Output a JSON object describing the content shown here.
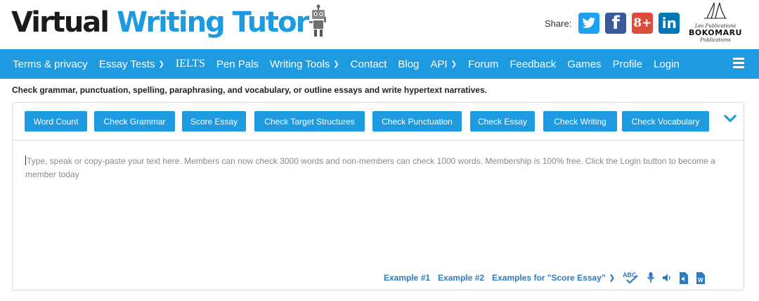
{
  "header": {
    "logo": {
      "part1": "Virtual",
      "part2": "Writing",
      "part3": "Tutor"
    },
    "share_label": "Share:",
    "social": {
      "gplus_label": "8+",
      "linkedin_label": "in"
    },
    "publisher": {
      "line1": "Les Publications",
      "line2": "BOKOMARU",
      "line3": "Publications"
    }
  },
  "nav": {
    "items": [
      {
        "label": "Terms & privacy"
      },
      {
        "label": "Essay Tests"
      },
      {
        "label": "IELTS"
      },
      {
        "label": "Pen Pals"
      },
      {
        "label": "Writing Tools"
      },
      {
        "label": "Contact"
      },
      {
        "label": "Blog"
      },
      {
        "label": "API"
      },
      {
        "label": "Forum"
      },
      {
        "label": "Feedback"
      },
      {
        "label": "Games"
      },
      {
        "label": "Profile"
      },
      {
        "label": "Login"
      }
    ]
  },
  "tagline": "Check grammar, punctuation, spelling, paraphrasing, and vocabulary, or outline essays and write hypertext narratives.",
  "toolbar": {
    "buttons": [
      {
        "label": "Word Count"
      },
      {
        "label": "Check Grammar"
      },
      {
        "label": "Score Essay"
      },
      {
        "label": "Check Target Structures"
      },
      {
        "label": "Check Punctuation"
      },
      {
        "label": "Check Essay"
      },
      {
        "label": "Check Writing"
      },
      {
        "label": "Check Vocabulary"
      }
    ]
  },
  "editor": {
    "placeholder": "Type, speak or copy-paste your text here. Members can now check 3000 words and non-members can check 1000 words. Membership is 100% free. Click the Login button to become a member today"
  },
  "footer": {
    "example1": "Example #1",
    "example2": "Example #2",
    "examples_score": "Examples for \"Score Essay\"",
    "spellcheck_label": "ABC",
    "doc_label": "W"
  },
  "colors": {
    "brand_blue": "#1e9be0",
    "link_blue": "#2b7cc4",
    "twitter": "#1da1f2",
    "facebook": "#3b5998",
    "gplus": "#dd4b39",
    "linkedin": "#0077b5"
  }
}
